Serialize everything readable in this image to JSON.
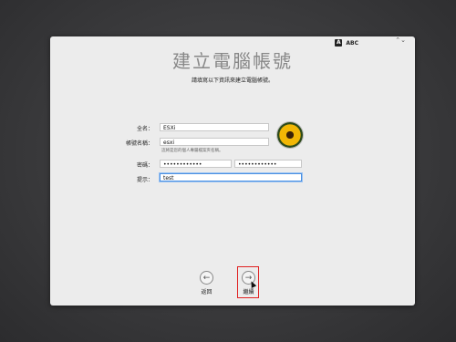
{
  "input_source": {
    "badge": "A",
    "label": "ABC",
    "arrows": "⌃⌄"
  },
  "title": "建立電腦帳號",
  "subtitle": "請填寫以下資訊來建立電腦帳號。",
  "form": {
    "full_name_label": "全名：",
    "full_name_value": "ESXi",
    "account_name_label": "帳號名稱：",
    "account_name_value": "esxi",
    "account_name_hint": "這將是您的個人專屬檔案夾名稱。",
    "password_label": "密碼：",
    "password_value": "••••••••••••",
    "verify_value": "••••••••••••",
    "hint_label": "提示：",
    "hint_value": "test"
  },
  "nav": {
    "back_label": "返回",
    "back_icon": "←",
    "continue_label": "繼續",
    "continue_icon": "→"
  }
}
